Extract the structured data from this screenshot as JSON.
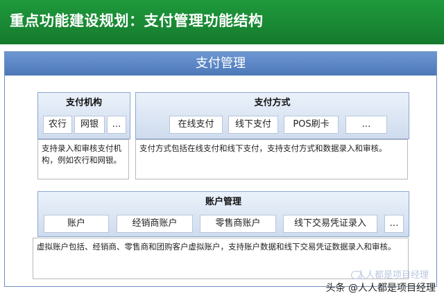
{
  "header": {
    "title": "重点功能建设规划：支付管理功能结构"
  },
  "frame": {
    "title": "支付管理"
  },
  "payment_institution": {
    "title": "支付机构",
    "items": [
      "农行",
      "网银",
      "…"
    ],
    "description": "支持录入和审核支付机构，例如农行和网银。"
  },
  "payment_method": {
    "title": "支付方式",
    "items": [
      "在线支付",
      "线下支付",
      "POS刷卡",
      "…"
    ],
    "description": "支付方式包括在线支付和线下支付，支持支付方式和数据录入和审核。"
  },
  "account_management": {
    "title": "账户管理",
    "items": [
      "账户",
      "经销商账户",
      "零售商账户",
      "线下交易凭证录入",
      "…"
    ],
    "description": "虚拟账户包括、经销商、零售商和团购客户虚拟账户，支持账户数据和线下交易凭证数据录入和审核。"
  },
  "watermark": {
    "text": "头条 @人人都是项目经理",
    "faded_text": "人人都是项目经理"
  },
  "colors": {
    "title_bar": "#1a8a36",
    "frame_header": "#5b86c4",
    "panel": "#d9e4f2"
  }
}
